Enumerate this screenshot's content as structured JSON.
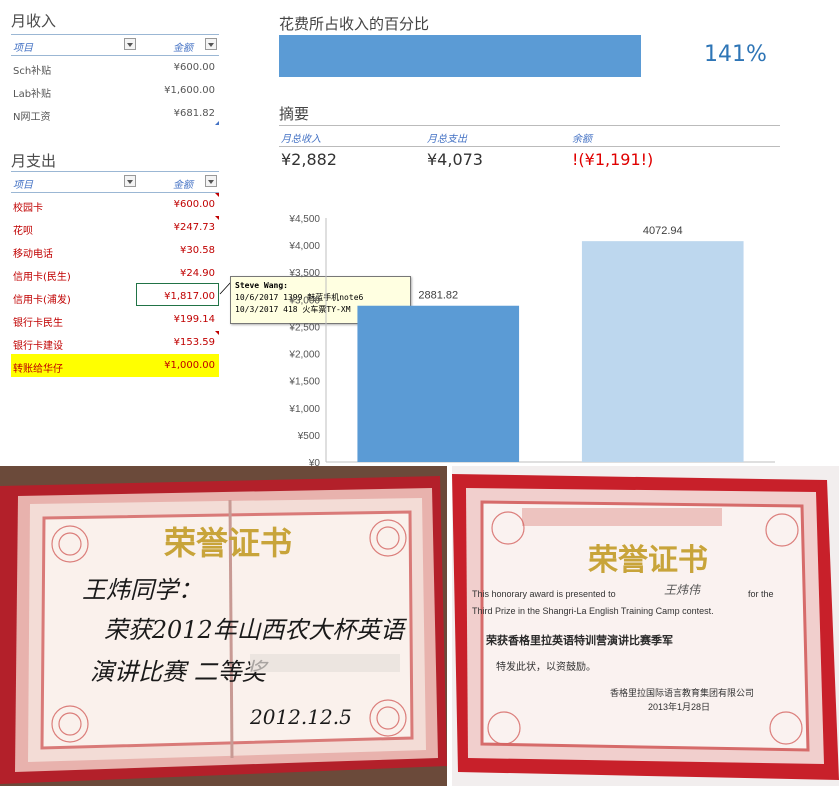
{
  "income": {
    "title": "月收入",
    "col_item": "项目",
    "col_amount": "金额",
    "rows": [
      {
        "item": "Sch补贴",
        "amount": "¥600.00"
      },
      {
        "item": "Lab补贴",
        "amount": "¥1,600.00"
      },
      {
        "item": "N网工资",
        "amount": "¥681.82"
      }
    ]
  },
  "expense": {
    "title": "月支出",
    "col_item": "项目",
    "col_amount": "金额",
    "rows": [
      {
        "item": "校园卡",
        "amount": "¥600.00"
      },
      {
        "item": "花呗",
        "amount": "¥247.73"
      },
      {
        "item": "移动电话",
        "amount": "¥30.58"
      },
      {
        "item": "信用卡(民生)",
        "amount": "¥24.90"
      },
      {
        "item": "信用卡(浦发)",
        "amount": "¥1,817.00"
      },
      {
        "item": "银行卡民生",
        "amount": "¥199.14"
      },
      {
        "item": "银行卡建设",
        "amount": "¥153.59"
      },
      {
        "item": "转账给华仔",
        "amount": "¥1,000.00"
      }
    ]
  },
  "comment": {
    "author": "Steve Wang:",
    "line1": "10/6/2017 1399 魅蓝手机note6",
    "line2": "10/3/2017 418 火车票TY-XM"
  },
  "percent": {
    "title": "花费所占收入的百分比",
    "value": "141%",
    "fraction": 1.41
  },
  "summary": {
    "title": "摘要",
    "income_label": "月总收入",
    "expense_label": "月总支出",
    "balance_label": "余额",
    "income_value": "¥2,882",
    "expense_value": "¥4,073",
    "balance_value": "!(¥1,191!)"
  },
  "chart_data": {
    "type": "bar",
    "categories": [
      "",
      ""
    ],
    "values": [
      2881.82,
      4072.94
    ],
    "value_labels": [
      "2881.82",
      "4072.94"
    ],
    "colors": [
      "#5b9bd5",
      "#bdd7ee"
    ],
    "ylim": [
      0,
      4500
    ],
    "yticks": [
      "¥0",
      "¥500",
      "¥1,000",
      "¥1,500",
      "¥2,000",
      "¥2,500",
      "¥3,000",
      "¥3,500",
      "¥4,000",
      "¥4,500"
    ],
    "title": "",
    "xlabel": "",
    "ylabel": ""
  },
  "cert_left": {
    "heading": "荣誉证书",
    "handwriting_1": "王炜同学：",
    "handwriting_2": "荣获2012年山西农大杯英语",
    "handwriting_3": "演讲比赛 二等奖",
    "date": "2012.12.5"
  },
  "cert_right": {
    "heading": "荣誉证书",
    "line1_a": "This honorary award is presented to",
    "name": "王炜伟",
    "line1_b": "for the",
    "line2": "Third Prize in the Shangri-La English Training Camp contest.",
    "line3": "荣获香格里拉英语特训营演讲比赛季军",
    "line4": "特发此状，以资鼓励。",
    "issuer": "香格里拉国际语言教育集团有限公司",
    "date": "2013年1月28日"
  }
}
